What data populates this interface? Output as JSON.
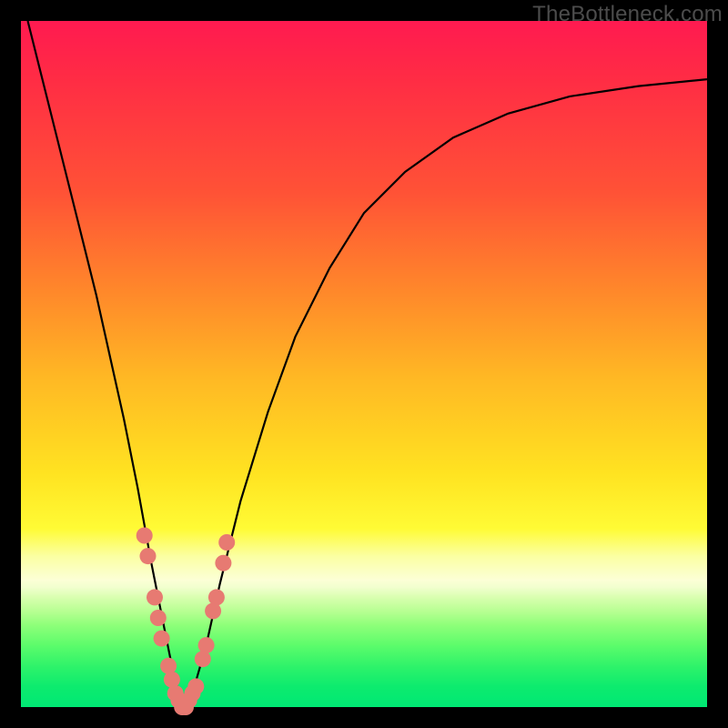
{
  "watermark": "TheBottleneck.com",
  "colors": {
    "frame": "#000000",
    "curve_stroke": "#000000",
    "marker_fill": "#e77a72",
    "marker_stroke": "#d85f57"
  },
  "chart_data": {
    "type": "line",
    "title": "",
    "xlabel": "",
    "ylabel": "",
    "xlim": [
      0,
      100
    ],
    "ylim": [
      0,
      100
    ],
    "series": [
      {
        "name": "bottleneck-curve",
        "x": [
          1,
          3,
          5,
          7,
          9,
          11,
          13,
          15,
          17,
          19,
          21,
          22,
          23,
          24,
          25,
          27,
          29,
          32,
          36,
          40,
          45,
          50,
          56,
          63,
          71,
          80,
          90,
          100
        ],
        "y": [
          100,
          92,
          84,
          76,
          68,
          60,
          51,
          42,
          32,
          21,
          11,
          6,
          2,
          0,
          2,
          9,
          18,
          30,
          43,
          54,
          64,
          72,
          78,
          83,
          86.5,
          89,
          90.5,
          91.5
        ]
      }
    ],
    "markers": {
      "name": "sample-points",
      "points": [
        {
          "x": 18.0,
          "y": 25
        },
        {
          "x": 18.5,
          "y": 22
        },
        {
          "x": 19.5,
          "y": 16
        },
        {
          "x": 20.0,
          "y": 13
        },
        {
          "x": 20.5,
          "y": 10
        },
        {
          "x": 21.5,
          "y": 6
        },
        {
          "x": 22.0,
          "y": 4
        },
        {
          "x": 22.5,
          "y": 2
        },
        {
          "x": 23.0,
          "y": 1
        },
        {
          "x": 23.5,
          "y": 0
        },
        {
          "x": 24.0,
          "y": 0
        },
        {
          "x": 24.5,
          "y": 1
        },
        {
          "x": 25.0,
          "y": 2
        },
        {
          "x": 25.5,
          "y": 3
        },
        {
          "x": 26.5,
          "y": 7
        },
        {
          "x": 27.0,
          "y": 9
        },
        {
          "x": 28.0,
          "y": 14
        },
        {
          "x": 28.5,
          "y": 16
        },
        {
          "x": 29.5,
          "y": 21
        },
        {
          "x": 30.0,
          "y": 24
        }
      ],
      "radius_px": 9
    }
  }
}
